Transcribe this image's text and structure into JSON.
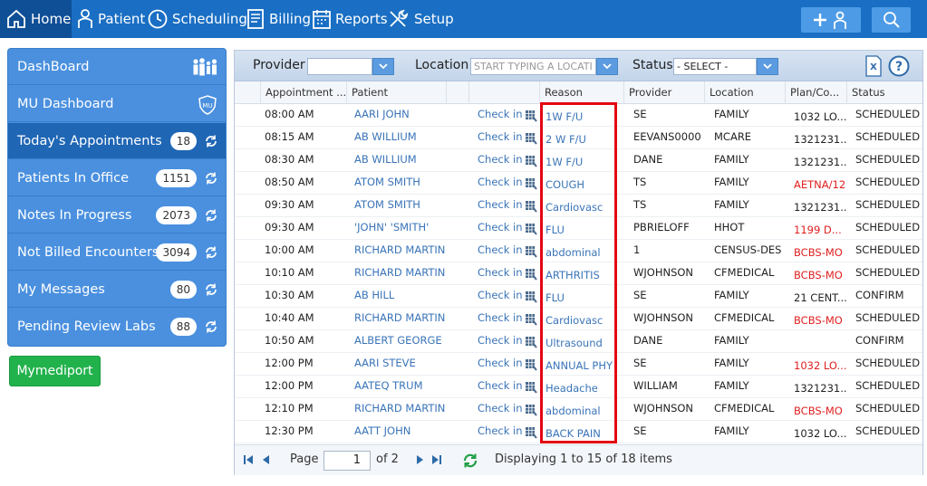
{
  "nav": {
    "items": [
      {
        "label": "Home",
        "icon": "home-icon"
      },
      {
        "label": "Patient",
        "icon": "patient-icon"
      },
      {
        "label": "Scheduling",
        "icon": "clock-icon"
      },
      {
        "label": "Billing",
        "icon": "billing-icon"
      },
      {
        "label": "Reports",
        "icon": "calendar-icon"
      },
      {
        "label": "Setup",
        "icon": "wrench-icon"
      }
    ]
  },
  "sidebar": {
    "items": [
      {
        "label": "DashBoard",
        "count": null,
        "icon": "family-icon"
      },
      {
        "label": "MU Dashboard",
        "count": null,
        "icon": "mu-shield-icon"
      },
      {
        "label": "Today's Appointments",
        "count": "18"
      },
      {
        "label": "Patients In Office",
        "count": "1151"
      },
      {
        "label": "Notes In Progress",
        "count": "2073"
      },
      {
        "label": "Not Billed Encounters",
        "count": "3094"
      },
      {
        "label": "My Messages",
        "count": "80"
      },
      {
        "label": "Pending Review Labs",
        "count": "88"
      }
    ]
  },
  "mymediport_label": "Mymediport",
  "filters": {
    "provider_label": "Provider",
    "provider_value": "",
    "location_label": "Location",
    "location_placeholder": "START TYPING A LOCATI",
    "status_label": "Status",
    "status_value": "- SELECT -"
  },
  "columns": [
    "Appointment ...",
    "Patient",
    "",
    "",
    "Reason",
    "Provider",
    "Location",
    "Plan/Co...",
    "Status"
  ],
  "rows": [
    {
      "time": "08:00 AM",
      "patient": "AARI JOHN",
      "action": "Check in",
      "reason": "1W F/U",
      "provider": "SE",
      "location": "FAMILY",
      "plan": "1032 LO...",
      "plan_red": false,
      "status": "SCHEDULED"
    },
    {
      "time": "08:15 AM",
      "patient": "AB WILLIUM",
      "action": "Check in",
      "reason": "2 W F/U",
      "provider": "EEVANS0000",
      "location": "MCARE",
      "plan": "1321231...",
      "plan_red": false,
      "status": "SCHEDULED"
    },
    {
      "time": "08:30 AM",
      "patient": "AB WILLIUM",
      "action": "Check in",
      "reason": "1W F/U",
      "provider": "DANE",
      "location": "FAMILY",
      "plan": "1321231...",
      "plan_red": false,
      "status": "SCHEDULED"
    },
    {
      "time": "08:50 AM",
      "patient": "ATOM SMITH",
      "action": "Check in",
      "reason": "COUGH",
      "provider": "TS",
      "location": "FAMILY",
      "plan": "AETNA/12",
      "plan_red": true,
      "status": "SCHEDULED"
    },
    {
      "time": "09:30 AM",
      "patient": "ATOM SMITH",
      "action": "Check in",
      "reason": "Cardiovasc",
      "provider": "TS",
      "location": "FAMILY",
      "plan": "1321231...",
      "plan_red": false,
      "status": "SCHEDULED"
    },
    {
      "time": "09:30 AM",
      "patient": "'JOHN' 'SMITH'",
      "action": "Check in",
      "reason": "FLU",
      "provider": "PBRIELOFF",
      "location": "HHOT",
      "plan": "1199 D...",
      "plan_red": true,
      "status": "SCHEDULED"
    },
    {
      "time": "10:00 AM",
      "patient": "RICHARD MARTIN",
      "action": "Check in",
      "reason": "abdominal",
      "provider": "1",
      "location": "CENSUS-DES",
      "plan": "BCBS-MO",
      "plan_red": true,
      "status": "SCHEDULED"
    },
    {
      "time": "10:10 AM",
      "patient": "RICHARD MARTIN",
      "action": "Check in",
      "reason": "ARTHRITIS",
      "provider": "WJOHNSON",
      "location": "CFMEDICAL",
      "plan": "BCBS-MO",
      "plan_red": true,
      "status": "SCHEDULED"
    },
    {
      "time": "10:30 AM",
      "patient": "AB HILL",
      "action": "Check in",
      "reason": "FLU",
      "provider": "SE",
      "location": "FAMILY",
      "plan": "21 CENT...",
      "plan_red": false,
      "status": "CONFIRM"
    },
    {
      "time": "10:40 AM",
      "patient": "RICHARD MARTIN",
      "action": "Check in",
      "reason": "Cardiovasc",
      "provider": "WJOHNSON",
      "location": "CFMEDICAL",
      "plan": "BCBS-MO",
      "plan_red": true,
      "status": "SCHEDULED"
    },
    {
      "time": "10:50 AM",
      "patient": "ALBERT GEORGE",
      "action": "Check in",
      "reason": "Ultrasound",
      "provider": "DANE",
      "location": "FAMILY",
      "plan": "",
      "plan_red": false,
      "status": "CONFIRM"
    },
    {
      "time": "12:00 PM",
      "patient": "AARI STEVE",
      "action": "Check in",
      "reason": "ANNUAL PHY",
      "provider": "SE",
      "location": "FAMILY",
      "plan": "1032 LO...",
      "plan_red": true,
      "status": "SCHEDULED"
    },
    {
      "time": "12:00 PM",
      "patient": "AATEQ TRUM",
      "action": "Check in",
      "reason": "Headache",
      "provider": "WILLIAM",
      "location": "FAMILY",
      "plan": "1321231...",
      "plan_red": false,
      "status": "SCHEDULED"
    },
    {
      "time": "12:10 PM",
      "patient": "RICHARD MARTIN",
      "action": "Check in",
      "reason": "abdominal",
      "provider": "WJOHNSON",
      "location": "CFMEDICAL",
      "plan": "BCBS-MO",
      "plan_red": true,
      "status": "SCHEDULED"
    },
    {
      "time": "12:30 PM",
      "patient": "AATT JOHN",
      "action": "Check in",
      "reason": "BACK PAIN",
      "provider": "SE",
      "location": "FAMILY",
      "plan": "1032 LO...",
      "plan_red": false,
      "status": "SCHEDULED"
    }
  ],
  "pager": {
    "page_label": "Page",
    "page_value": "1",
    "of_label": "of 2",
    "summary": "Displaying 1 to 15 of 18 items"
  },
  "colors": {
    "nav_bg": "#1a6fc4",
    "sidebar_bg": "#4a90df",
    "active_bg": "#1f66b5",
    "link": "#3a74b8",
    "plan_alert": "#e02020",
    "green_button": "#22b24c",
    "highlight": "#e30613"
  }
}
